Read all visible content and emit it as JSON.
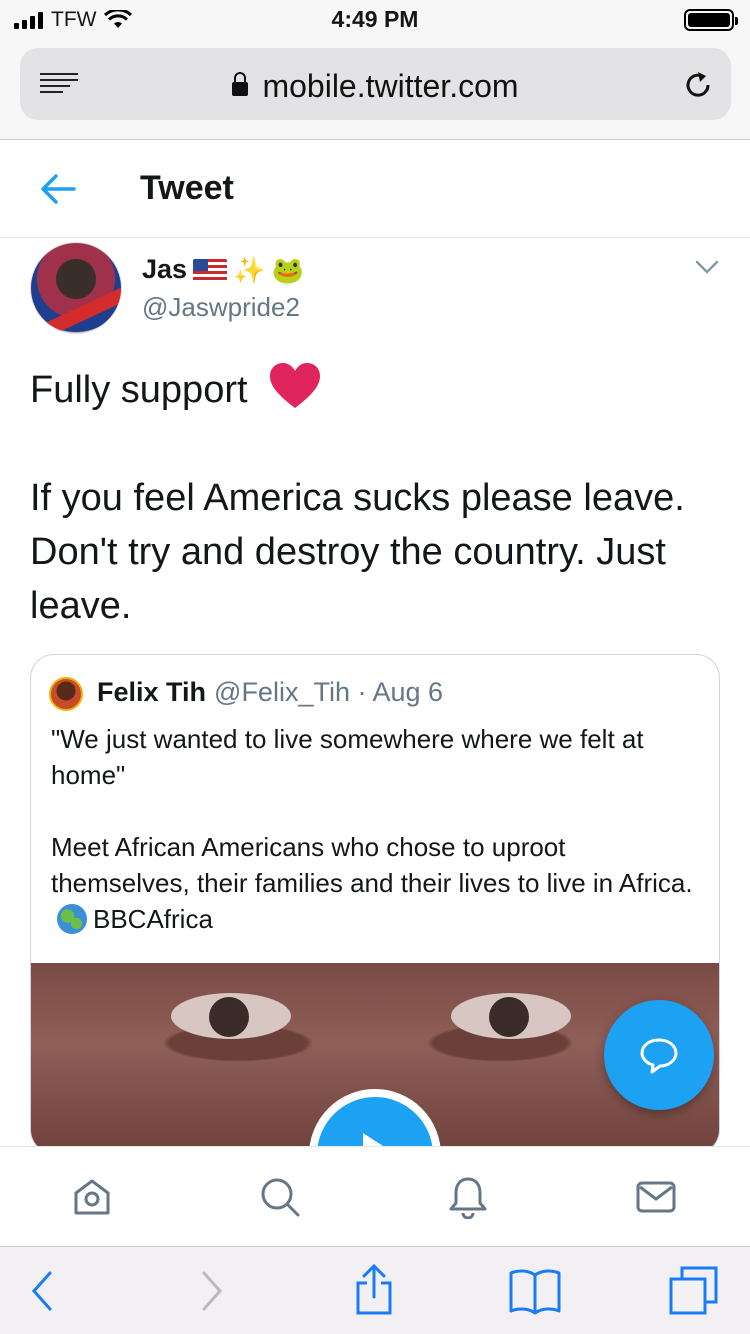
{
  "status_bar": {
    "carrier": "TFW",
    "time": "4:49 PM"
  },
  "browser": {
    "url": "mobile.twitter.com"
  },
  "header": {
    "title": "Tweet"
  },
  "tweet": {
    "author_name": "Jas",
    "author_emojis": [
      "us-flag",
      "✨",
      "🐸"
    ],
    "author_handle": "@Jaswpride2",
    "text_line_1": "Fully support",
    "text_paragraph_2": "If you feel America sucks please leave. Don't try and destroy the country. Just leave."
  },
  "quoted_tweet": {
    "author_name": "Felix Tih",
    "author_handle": "@Felix_Tih",
    "separator": "·",
    "date": "Aug 6",
    "paragraph_1": "\"We just wanted to live somewhere where we felt at home\"",
    "paragraph_2_start": "Meet African Americans who chose to uproot themselves, their families and their lives to live in Africa.",
    "paragraph_2_end": "BBCAfrica"
  },
  "icons": {
    "nav": [
      "home-icon",
      "search-icon",
      "bell-icon",
      "mail-icon"
    ],
    "toolbar": [
      "back-icon",
      "forward-icon",
      "share-icon",
      "bookmarks-icon",
      "tabs-icon"
    ]
  },
  "colors": {
    "accent": "#1da1f2",
    "heart": "#e0245e",
    "secondary_text": "#657786"
  }
}
